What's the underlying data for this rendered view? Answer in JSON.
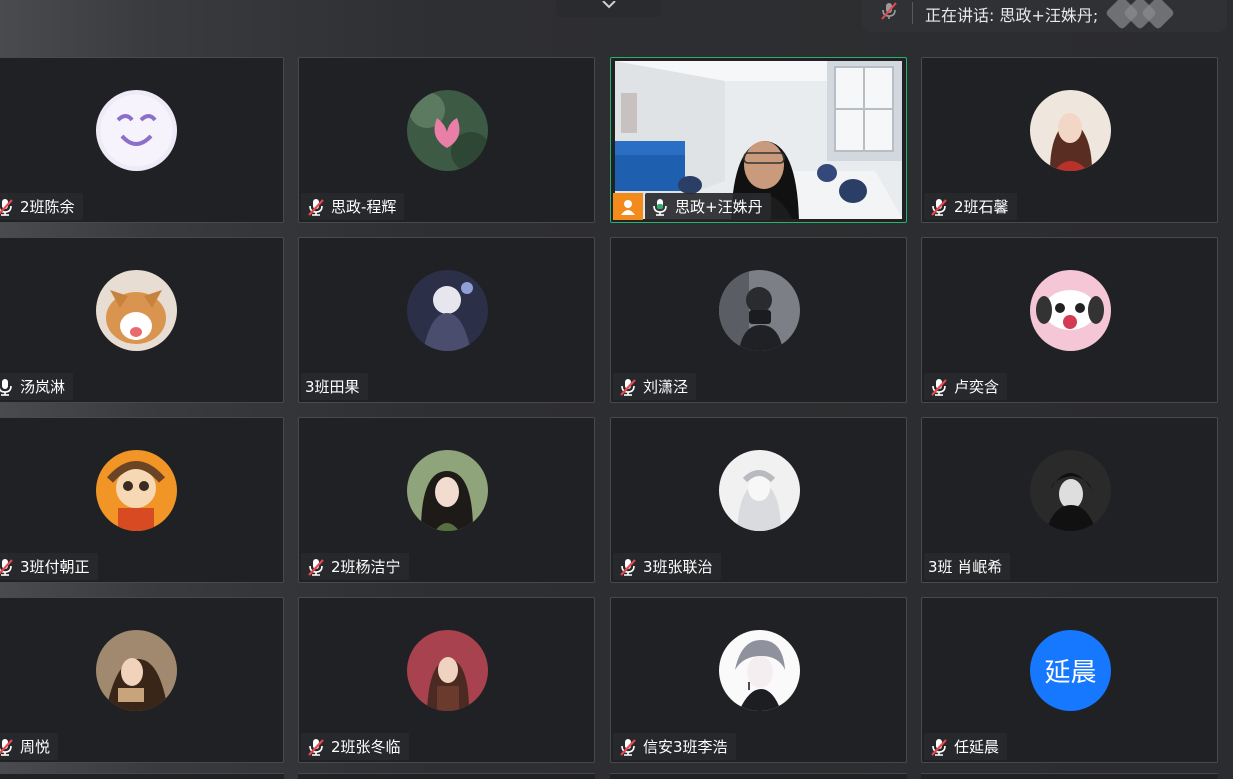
{
  "speaking_banner": {
    "text": "正在讲话: 思政+汪姝丹;"
  },
  "participants": [
    {
      "name": "2班陈余",
      "mic": "muted"
    },
    {
      "name": "思政-程辉",
      "mic": "muted"
    },
    {
      "name": "思政+汪姝丹",
      "mic": "active"
    },
    {
      "name": "2班石馨",
      "mic": "muted"
    },
    {
      "name": "汤岚淋",
      "mic": "on"
    },
    {
      "name": "3班田果",
      "mic": "none"
    },
    {
      "name": "刘潇泾",
      "mic": "muted"
    },
    {
      "name": "卢奕含",
      "mic": "muted"
    },
    {
      "name": "3班付朝正",
      "mic": "muted"
    },
    {
      "name": "2班杨洁宁",
      "mic": "muted"
    },
    {
      "name": "3班张联治",
      "mic": "muted"
    },
    {
      "name": "3班 肖岷希",
      "mic": "none"
    },
    {
      "name": "周悦",
      "mic": "muted"
    },
    {
      "name": "2班张冬临",
      "mic": "muted"
    },
    {
      "name": "信安3班李浩",
      "mic": "muted"
    },
    {
      "name": "任延晨",
      "mic": "muted",
      "avatar_text": "延晨"
    }
  ],
  "colors": {
    "muted_red": "#e5484d",
    "active_green": "#2fb06a",
    "avatar_blue": "#1677ff",
    "cam_orange": "#f28a1c"
  }
}
